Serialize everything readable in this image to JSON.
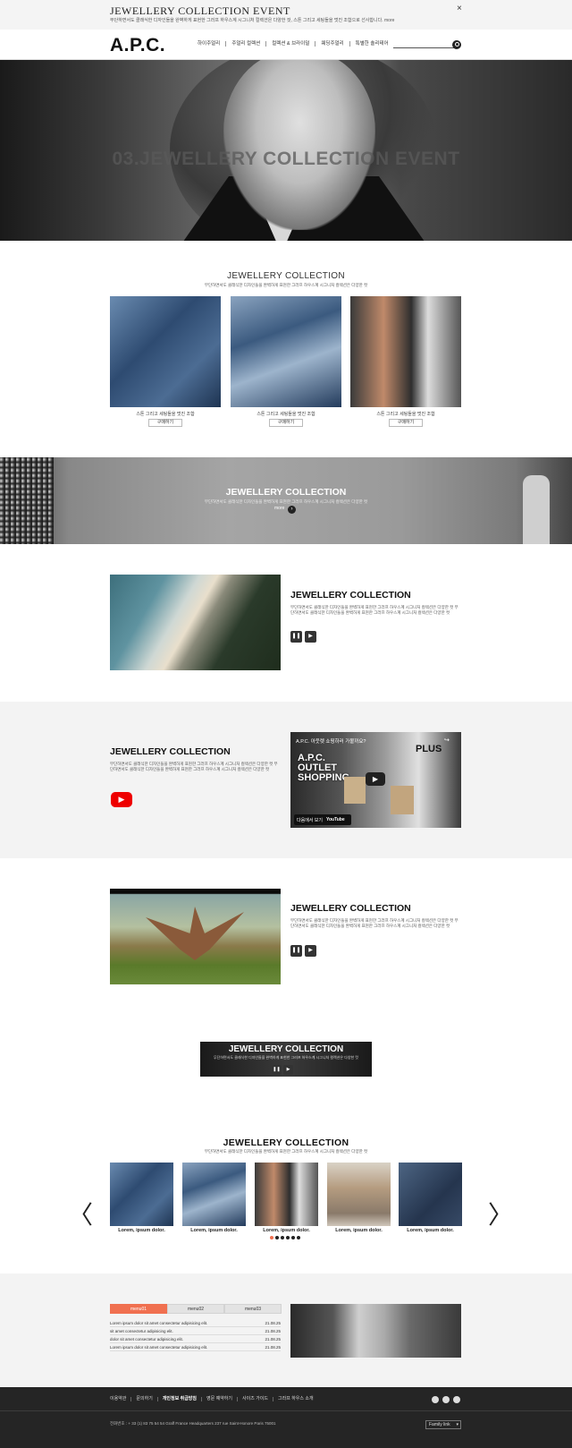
{
  "top_banner": {
    "title": "JEWELLERY COLLECTION EVENT",
    "desc": "무단하면서도 클래식한 디자인들을 완벽하게 표현한 그러프 하우스계 시그니처 컬렉션은 다양한 컷, 스톤 그리고 세팅들을 멋진 조합으로 선사합니다. more",
    "close": "×"
  },
  "header": {
    "logo": "A.P.C.",
    "nav": [
      "하이주얼리",
      "주얼리 컬렉션",
      "컬렉션 & 브라이덜",
      "웨딩주얼리",
      "특별한 솔리테어"
    ]
  },
  "hero": {
    "title": "03.JEWELLERY COLLECTION EVENT"
  },
  "collection": {
    "title": "JEWELLERY COLLECTION",
    "sub": "무단하면서도 클래식한 디자인들을 완벽하게 표현한 그러프 하우스계 시그니처 컬렉션은 다양한 컷",
    "products": [
      {
        "caption": "스톤 그리고 세팅들을 멋진 조합",
        "buy": "구매하기"
      },
      {
        "caption": "스톤 그리고 세팅들을 멋진 조합",
        "buy": "구매하기"
      },
      {
        "caption": "스톤 그리고 세팅들을 멋진 조합",
        "buy": "구매하기"
      }
    ]
  },
  "band": {
    "title": "JEWELLERY COLLECTION",
    "sub": "무단하면서도 클래식한 디자인들을 완벽하게 표현한 그러프 하우스계 시그니처 컬렉션은 다양한 컷",
    "more": "more"
  },
  "video1": {
    "title": "JEWELLERY COLLECTION",
    "desc": "무단하면서도 클래식한 디자인들을 완벽하게 표현한 그러프 하우스계 시그니처 컬렉션은 다양한 컷 무단하면서도 클래식한 디자인들을 완벽하게 표현한 그러프 하우스계 시그니처 컬렉션은 다양한 컷"
  },
  "video2": {
    "title": "JEWELLERY COLLECTION",
    "desc": "무단하면서도 클래식한 디자인들을 완벽하게 표현한 그러프 하우스계 시그니처 컬렉션은 다양한 컷 무단하면서도 클래식한 디자인들을 완벽하게 표현한 그러프 하우스계 시그니처 컬렉션은 다양한 컷",
    "yt_title": "A.P.C. 아웃렛 쇼핑하러 가볼까요?",
    "yt_big": "A.P.C. OUTLET SHOPPING",
    "yt_plus": "PLUS",
    "yt_watch": "다음에서 보기",
    "yt_brand": "YouTube"
  },
  "video3": {
    "title": "JEWELLERY COLLECTION",
    "desc": "무단하면서도 클래식한 디자인들을 완벽하게 표현한 그러프 하우스계 시그니처 컬렉션은 다양한 컷 무단하면서도 클래식한 디자인들을 완벽하게 표현한 그러프 하우스계 시그니처 컬렉션은 다양한 컷"
  },
  "mini_banner": {
    "title": "JEWELLERY COLLECTION",
    "sub": "무단하면서도 클래식한 디자인들을 완벽하게 표현한 그러프 하우스계 시그니처 컬렉션은 다양한 컷"
  },
  "carousel": {
    "title": "JEWELLERY COLLECTION",
    "sub": "무단하면서도 클래식한 디자인들을 완벽하게 표현한 그러프 하우스계 시그니처 컬렉션은 다양한 컷",
    "items": [
      "Lorem, ipsum dolor.",
      "Lorem, ipsum dolor.",
      "Lorem, ipsum dolor.",
      "Lorem, ipsum dolor.",
      "Lorem, ipsum dolor."
    ],
    "prev": "〈",
    "next": "〉",
    "dot_count": 6,
    "active_dot": 0,
    "active_color": "#f07050"
  },
  "tabs": {
    "labels": [
      "menu01",
      "menu02",
      "menu03"
    ],
    "rows": [
      {
        "text": "Lorem ipsum dolor sit amet consectetur adipisicing elit.",
        "date": "21.08.25"
      },
      {
        "text": "sit amet consectetur adipisicing elit.",
        "date": "21.08.25"
      },
      {
        "text": "dolor sit amet consectetur adipisicing elit.",
        "date": "21.08.25"
      },
      {
        "text": "Lorem ipsum dolor sit amet consectetur adipisicing elit.",
        "date": "21.08.25"
      }
    ]
  },
  "footer": {
    "links": [
      "이용약관",
      "문의하기",
      "개인정보 취급방침",
      "영문 예약하기",
      "사이즈 가이드",
      "그라프 하우스 소개"
    ],
    "address": "전화번호 : + 33 (1) 83 75 54 54 Graff France Headquarters 237 rue Saint-Honore Paris 75001",
    "family": "Family link"
  },
  "colors": {
    "accent": "#f07050",
    "footer_bg": "#252525",
    "youtube": "#e00000"
  }
}
